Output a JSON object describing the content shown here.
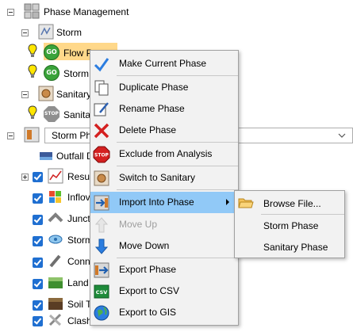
{
  "tree": {
    "root_label": "Phase Management",
    "storm_label": "Storm",
    "flow_path_label": "Flow Pa",
    "storm_phase_label": "Storm",
    "sanitary_label": "Sanitary",
    "sanitary_phase_label": "Sanita",
    "storm_phase_select": "Storm Pha",
    "outfall_label": "Outfall D",
    "results_label": "Resul",
    "inflow_label": "Inflov",
    "junction_label": "Junct",
    "storm_item_label": "Storm",
    "conduit_label": "Conne",
    "land_label": "Land",
    "soil_label": "Soil T",
    "clash_label": "Clash",
    "go_badge": "GO",
    "stop_badge": "STOP"
  },
  "context_menu": {
    "items": [
      {
        "label": "Make Current Phase",
        "icon": "checkmark-icon"
      },
      {
        "label": "Duplicate Phase",
        "icon": "duplicate-icon"
      },
      {
        "label": "Rename Phase",
        "icon": "rename-icon"
      },
      {
        "label": "Delete Phase",
        "icon": "delete-x-icon"
      },
      {
        "label": "Exclude from Analysis",
        "icon": "stop-sign-icon"
      },
      {
        "label": "Switch to Sanitary",
        "icon": "sanitary-icon"
      },
      {
        "label": "Import Into Phase",
        "icon": "import-icon"
      },
      {
        "label": "Move Up",
        "icon": "arrow-up-icon"
      },
      {
        "label": "Move Down",
        "icon": "arrow-down-icon"
      },
      {
        "label": "Export Phase",
        "icon": "export-phase-icon"
      },
      {
        "label": "Export to CSV",
        "icon": "csv-icon"
      },
      {
        "label": "Export to GIS",
        "icon": "globe-icon"
      }
    ],
    "csv_badge": "CSV",
    "active_item": "Import Into Phase",
    "disabled_item": "Move Up"
  },
  "submenu": {
    "items": [
      {
        "label": "Browse File...",
        "icon": "folder-open-icon"
      },
      {
        "label": "Storm Phase"
      },
      {
        "label": "Sanitary Phase"
      }
    ]
  },
  "colors": {
    "highlight": "#91c9f7",
    "selected_row": "#ffd88a",
    "checkbox": "#1f6fd1"
  }
}
